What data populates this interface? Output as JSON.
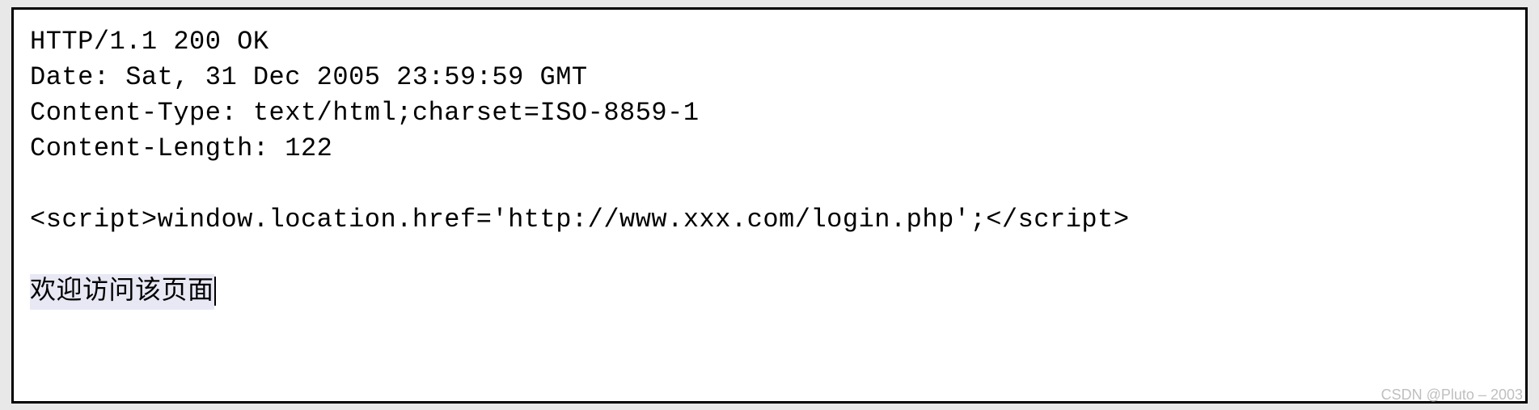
{
  "http_response": {
    "status_line": "HTTP/1.1 200 OK",
    "date_header": "Date: Sat, 31 Dec 2005 23:59:59 GMT",
    "content_type_header": "Content-Type: text/html;charset=ISO-8859-1",
    "content_length_header": "Content-Length: 122",
    "body_script": "<script>window.location.href='http://www.xxx.com/login.php';</script>",
    "body_text": "欢迎访问该页面"
  },
  "watermark": "CSDN @Pluto – 2003"
}
